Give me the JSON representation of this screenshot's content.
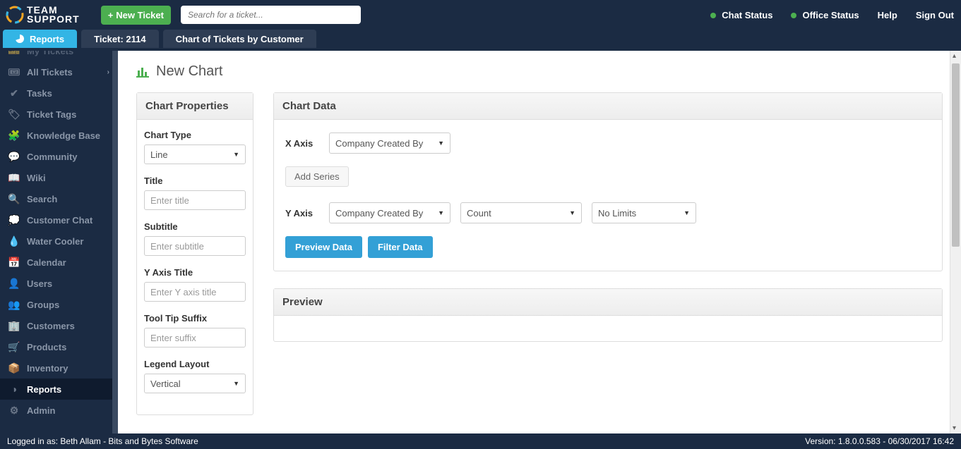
{
  "brand": {
    "top": "TEAM",
    "bot": "SUPPORT"
  },
  "topbar": {
    "newTicket": "New Ticket",
    "searchPlaceholder": "Search for a ticket...",
    "chatStatus": "Chat Status",
    "officeStatus": "Office Status",
    "help": "Help",
    "signOut": "Sign Out"
  },
  "tabs": {
    "reports": "Reports",
    "ticket": "Ticket: 2114",
    "chart": "Chart of Tickets by Customer"
  },
  "sidebar": {
    "items": [
      {
        "label": "My Tickets",
        "icon": "ticket"
      },
      {
        "label": "All Tickets",
        "icon": "tickets",
        "chev": true
      },
      {
        "label": "Tasks",
        "icon": "check"
      },
      {
        "label": "Ticket Tags",
        "icon": "tag"
      },
      {
        "label": "Knowledge Base",
        "icon": "puzzle"
      },
      {
        "label": "Community",
        "icon": "chat"
      },
      {
        "label": "Wiki",
        "icon": "book"
      },
      {
        "label": "Search",
        "icon": "search"
      },
      {
        "label": "Customer Chat",
        "icon": "bubble"
      },
      {
        "label": "Water Cooler",
        "icon": "drop"
      },
      {
        "label": "Calendar",
        "icon": "cal"
      },
      {
        "label": "Users",
        "icon": "user"
      },
      {
        "label": "Groups",
        "icon": "group"
      },
      {
        "label": "Customers",
        "icon": "building"
      },
      {
        "label": "Products",
        "icon": "cart"
      },
      {
        "label": "Inventory",
        "icon": "box"
      },
      {
        "label": "Reports",
        "icon": "pie",
        "active": true
      },
      {
        "label": "Admin",
        "icon": "gear"
      }
    ]
  },
  "page": {
    "title": "New Chart",
    "chartPropsHeader": "Chart Properties",
    "chartDataHeader": "Chart Data",
    "previewHeader": "Preview",
    "labels": {
      "chartType": "Chart Type",
      "title": "Title",
      "subtitle": "Subtitle",
      "yAxisTitle": "Y Axis Title",
      "tooltipSuffix": "Tool Tip Suffix",
      "legendLayout": "Legend Layout",
      "xAxis": "X Axis",
      "yAxis": "Y Axis"
    },
    "values": {
      "chartType": "Line",
      "legendLayout": "Vertical",
      "xAxisField": "Company Created By",
      "yAxisField": "Company Created By",
      "yAxisAgg": "Count",
      "yAxisLimit": "No Limits"
    },
    "placeholders": {
      "title": "Enter title",
      "subtitle": "Enter subtitle",
      "yAxisTitle": "Enter Y axis title",
      "tooltipSuffix": "Enter suffix"
    },
    "buttons": {
      "addSeries": "Add Series",
      "previewData": "Preview Data",
      "filterData": "Filter Data"
    }
  },
  "footer": {
    "left": "Logged in as: Beth Allam - Bits and Bytes Software",
    "right": "Version: 1.8.0.0.583 - 06/30/2017 16:42"
  }
}
